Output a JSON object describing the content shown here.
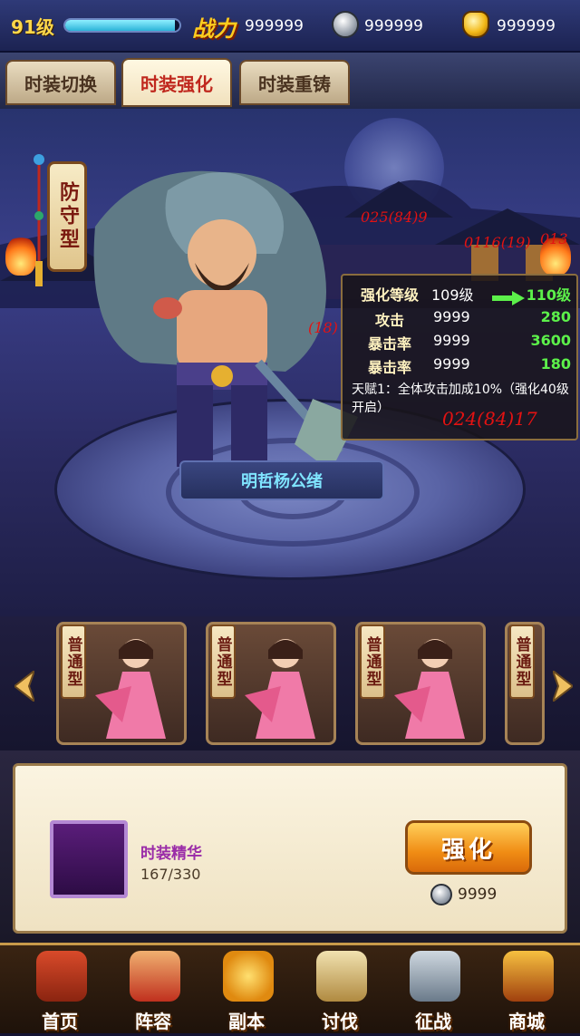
{
  "top": {
    "level": "91级",
    "exp_fraction": 0.96,
    "power_label": "战力",
    "power_value": "999999",
    "silver_value": "999999",
    "gold_value": "999999"
  },
  "tabs": [
    {
      "label": "时装切换",
      "active": false
    },
    {
      "label": "时装强化",
      "active": true
    },
    {
      "label": "时装重铸",
      "active": false
    }
  ],
  "stage": {
    "type_badge": "防守型",
    "character_name": "明哲杨公绪"
  },
  "stats": {
    "level_label": "强化等级",
    "level_current": "109级",
    "level_next": "110级",
    "rows": [
      {
        "label": "攻击",
        "value": "9999",
        "next": "280"
      },
      {
        "label": "暴击率",
        "value": "9999",
        "next": "3600"
      },
      {
        "label": "暴击率",
        "value": "9999",
        "next": "180"
      }
    ],
    "talent": "天赋1：全体攻击加成10%（强化40级开启）"
  },
  "annotations": [
    "025(84)9",
    "0116(19)",
    "013",
    "(18)",
    "024(84)17"
  ],
  "costumes": [
    {
      "type": "普通型"
    },
    {
      "type": "普通型"
    },
    {
      "type": "普通型"
    },
    {
      "type": "普通型"
    }
  ],
  "upgrade": {
    "item_name": "时装精华",
    "item_count": "167/330",
    "button_label": "强化",
    "cost": "9999"
  },
  "nav": [
    {
      "label": "首页",
      "icon": "home-icon"
    },
    {
      "label": "阵容",
      "icon": "lineup-icon"
    },
    {
      "label": "副本",
      "icon": "dungeon-icon"
    },
    {
      "label": "讨伐",
      "icon": "crusade-icon"
    },
    {
      "label": "征战",
      "icon": "campaign-icon"
    },
    {
      "label": "商城",
      "icon": "shop-icon"
    }
  ],
  "colors": {
    "accent_gold": "#ffcc1e",
    "stat_increase": "#5cf04a",
    "name_cyan": "#7fe4ff",
    "button_orange": "#f08c14"
  }
}
